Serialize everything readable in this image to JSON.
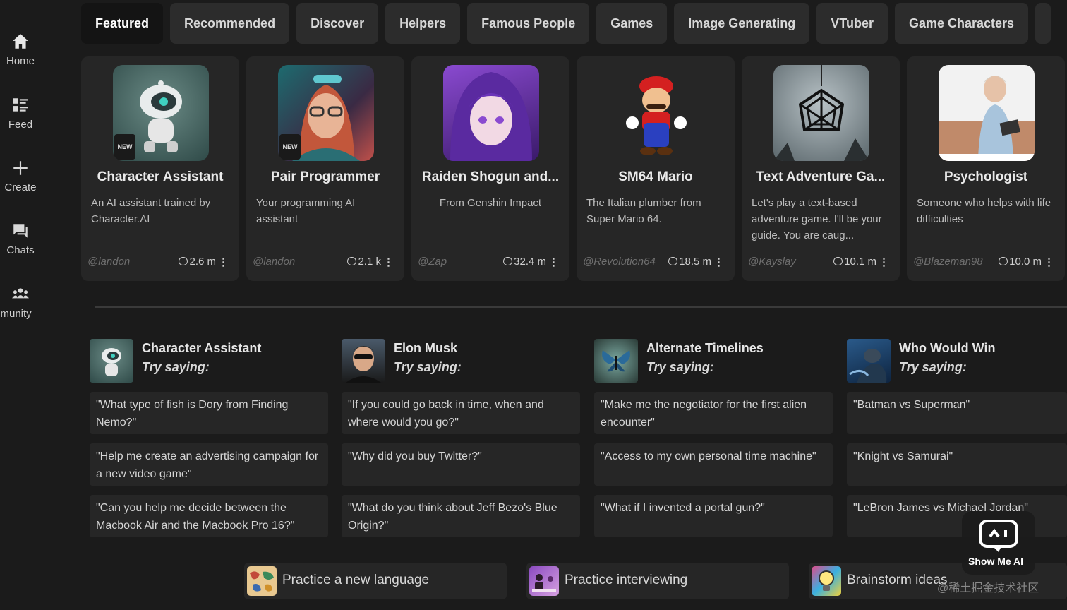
{
  "sidebar": {
    "items": [
      {
        "label": "Home",
        "icon": "home-icon"
      },
      {
        "label": "Feed",
        "icon": "feed-icon"
      },
      {
        "label": "Create",
        "icon": "plus-icon"
      },
      {
        "label": "Chats",
        "icon": "chat-icon"
      },
      {
        "label": "mmunity",
        "icon": "community-icon"
      }
    ]
  },
  "tabs": [
    "Featured",
    "Recommended",
    "Discover",
    "Helpers",
    "Famous People",
    "Games",
    "Image Generating",
    "VTuber",
    "Game Characters"
  ],
  "cards": [
    {
      "title": "Character Assistant",
      "desc": "An AI assistant trained by Character.AI",
      "author": "@landon",
      "count": "2.6 m",
      "badge": "NEW"
    },
    {
      "title": "Pair Programmer",
      "desc": "Your programming AI assistant",
      "author": "@landon",
      "count": "2.1 k",
      "badge": "NEW"
    },
    {
      "title": "Raiden Shogun and...",
      "desc": "From Genshin Impact",
      "author": "@Zap",
      "count": "32.4 m"
    },
    {
      "title": "SM64 Mario",
      "desc": "The Italian plumber from Super Mario 64.",
      "author": "@Revolution64",
      "count": "18.5 m"
    },
    {
      "title": "Text Adventure Ga...",
      "desc": "Let's play a text-based adventure game. I'll be your guide. You are caug...",
      "author": "@Kayslay",
      "count": "10.1 m"
    },
    {
      "title": "Psychologist",
      "desc": "Someone who helps with life difficulties",
      "author": "@Blazeman98",
      "count": "10.0 m"
    }
  ],
  "try_columns": [
    {
      "name": "Character Assistant",
      "try": "Try saying:",
      "prompts": [
        "\"What type of fish is Dory from Finding Nemo?\"",
        "\"Help me create an advertising campaign for a new video game\"",
        "\"Can you help me decide between the Macbook Air and the Macbook Pro 16?\""
      ]
    },
    {
      "name": "Elon Musk",
      "try": "Try saying:",
      "prompts": [
        "\"If you could go back in time, when and where would you go?\"",
        "\"Why did you buy Twitter?\"",
        "\"What do you think about Jeff Bezo's Blue Origin?\""
      ]
    },
    {
      "name": "Alternate Timelines",
      "try": "Try saying:",
      "prompts": [
        "\"Make me the negotiator for the first alien encounter\"",
        "\"Access to my own personal time machine\"",
        "\"What if I invented a portal gun?\""
      ]
    },
    {
      "name": "Who Would Win",
      "try": "Try saying:",
      "prompts": [
        "\"Batman vs Superman\"",
        "\"Knight vs Samurai\"",
        "\"LeBron James vs Michael Jordan\""
      ]
    }
  ],
  "categories": [
    "Practice a new language",
    "Practice interviewing",
    "Brainstorm ideas"
  ],
  "watermark": {
    "brand": "Show Me AI",
    "site": "@稀土掘金技术社区"
  },
  "colors": {
    "background": "#1b1b1b",
    "card": "#262626",
    "tab": "#2c2c2c",
    "tab_active": "#141414"
  }
}
